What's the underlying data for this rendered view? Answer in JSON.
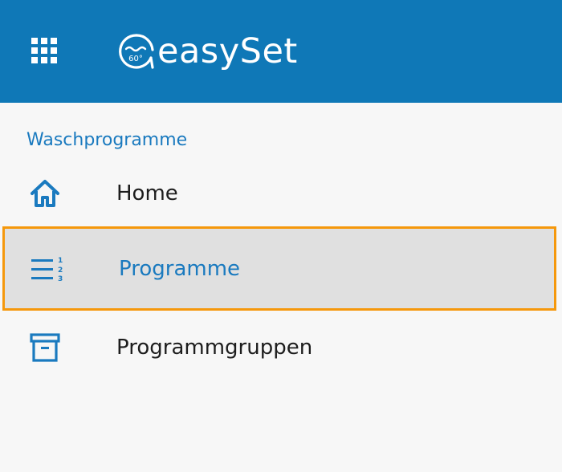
{
  "header": {
    "app_name": "easySet",
    "logo_badge": "60°",
    "apps_icon": "grid-icon",
    "background_color": "#0f78b7"
  },
  "sidebar": {
    "section_title": "Waschprogramme",
    "accent_color": "#1a7abf",
    "highlight_color": "#f5980c",
    "items": [
      {
        "label": "Home",
        "icon": "home-icon",
        "active": false
      },
      {
        "label": "Programme",
        "icon": "numbered-list-icon",
        "active": true
      },
      {
        "label": "Programmgruppen",
        "icon": "archive-box-icon",
        "active": false
      }
    ]
  }
}
